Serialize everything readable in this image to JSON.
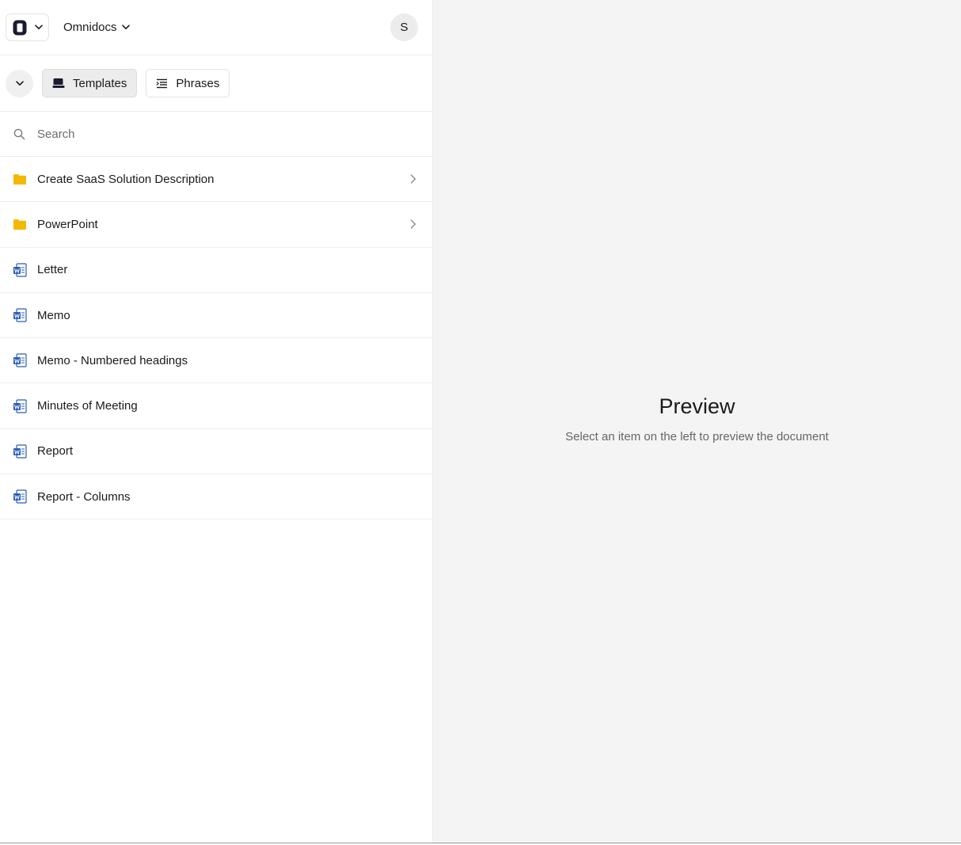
{
  "header": {
    "workspace_name": "Omnidocs",
    "avatar_initial": "S"
  },
  "tabs": [
    {
      "label": "Templates",
      "active": true,
      "icon": "templates-icon"
    },
    {
      "label": "Phrases",
      "active": false,
      "icon": "phrases-icon"
    }
  ],
  "search": {
    "placeholder": "Search",
    "value": ""
  },
  "items": [
    {
      "label": "Create SaaS Solution Description",
      "type": "folder",
      "icon": "folder-icon"
    },
    {
      "label": "PowerPoint",
      "type": "folder",
      "icon": "folder-icon"
    },
    {
      "label": "Letter",
      "type": "word-document",
      "icon": "word-document-icon"
    },
    {
      "label": "Memo",
      "type": "word-document",
      "icon": "word-document-icon"
    },
    {
      "label": "Memo - Numbered headings",
      "type": "word-document",
      "icon": "word-document-icon"
    },
    {
      "label": "Minutes of Meeting",
      "type": "word-document",
      "icon": "word-document-icon"
    },
    {
      "label": "Report",
      "type": "word-document",
      "icon": "word-document-icon"
    },
    {
      "label": "Report - Columns",
      "type": "word-document",
      "icon": "word-document-icon"
    }
  ],
  "preview": {
    "title": "Preview",
    "subtitle": "Select an item on the left to preview the document"
  },
  "colors": {
    "folder": "#f5b800",
    "word_blue": "#2b5cb8",
    "preview_bg": "#f4f4f4"
  }
}
